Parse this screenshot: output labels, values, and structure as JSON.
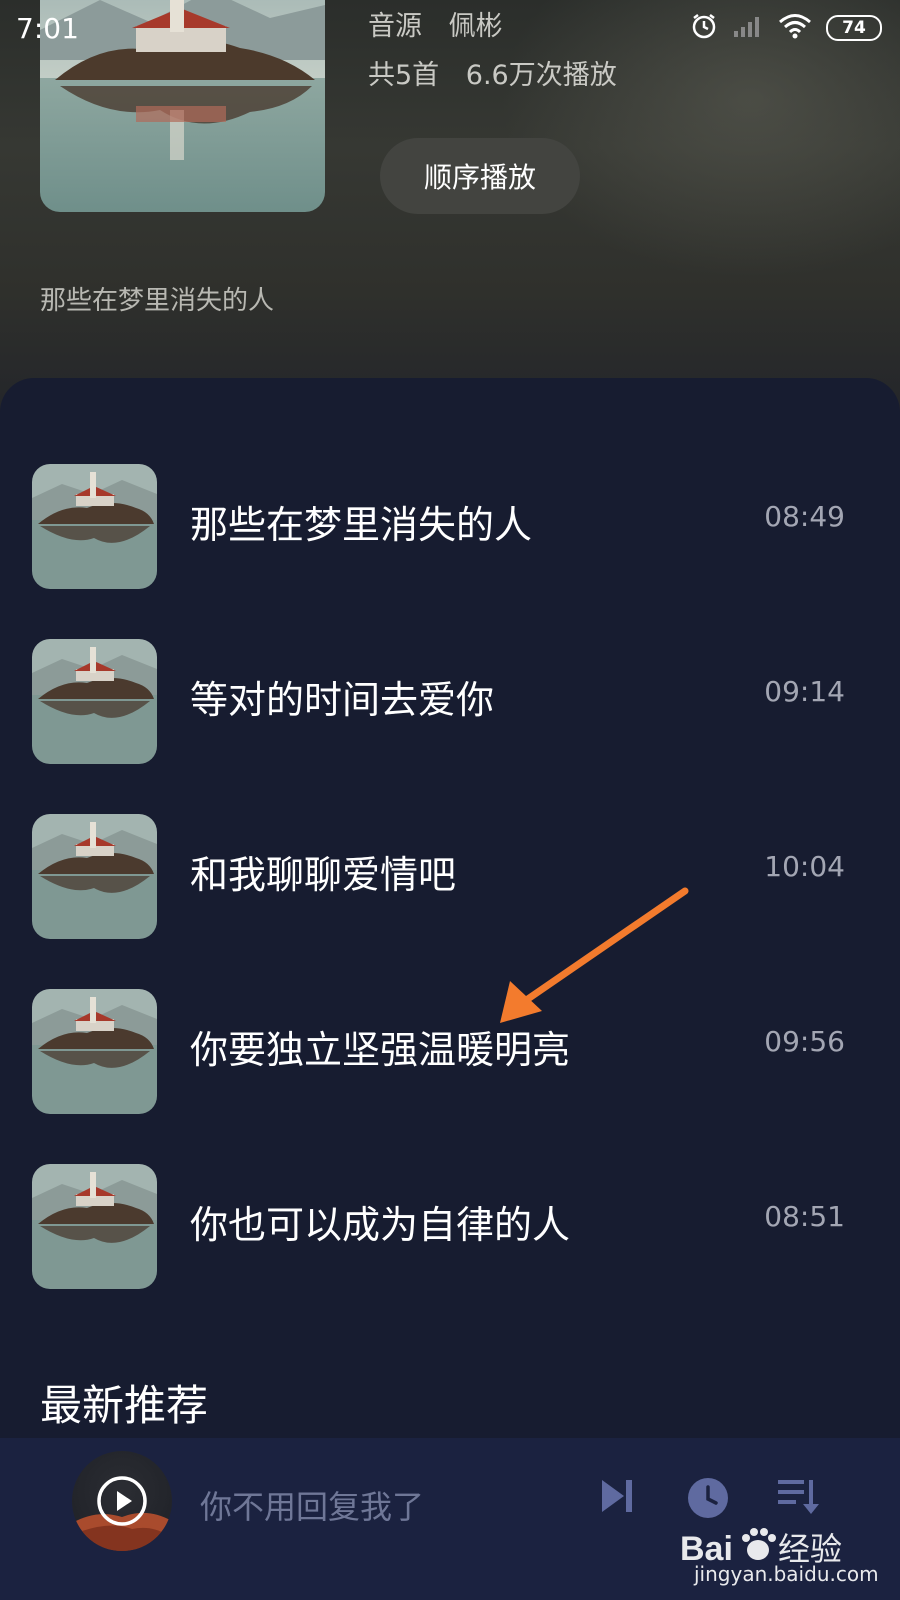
{
  "status_bar": {
    "time": "7:01",
    "battery": "74"
  },
  "album": {
    "source_label": "音源",
    "artist": "佩彬",
    "stats": "共5首",
    "plays": "6.6万次播放",
    "play_order_button": "顺序播放",
    "description": "那些在梦里消失的人"
  },
  "tracks": [
    {
      "title": "那些在梦里消失的人",
      "duration": "08:49"
    },
    {
      "title": "等对的时间去爱你",
      "duration": "09:14"
    },
    {
      "title": "和我聊聊爱情吧",
      "duration": "10:04"
    },
    {
      "title": "你要独立坚强温暖明亮",
      "duration": "09:56"
    },
    {
      "title": "你也可以成为自律的人",
      "duration": "08:51"
    }
  ],
  "section_title": "最新推荐",
  "player": {
    "now_playing": "你不用回复我了"
  },
  "watermark": {
    "brand_text": "Baidu经验",
    "url": "jingyan.baidu.com"
  },
  "icons": [
    "alarm-icon",
    "signal-icon",
    "wifi-icon",
    "battery-icon",
    "play-icon",
    "next-icon",
    "timer-icon",
    "playlist-icon",
    "arrow-annotation"
  ],
  "colors": {
    "panel_bg": "#171c30",
    "player_bg": "#1b2240",
    "accent_arrow": "#f37b2d"
  }
}
